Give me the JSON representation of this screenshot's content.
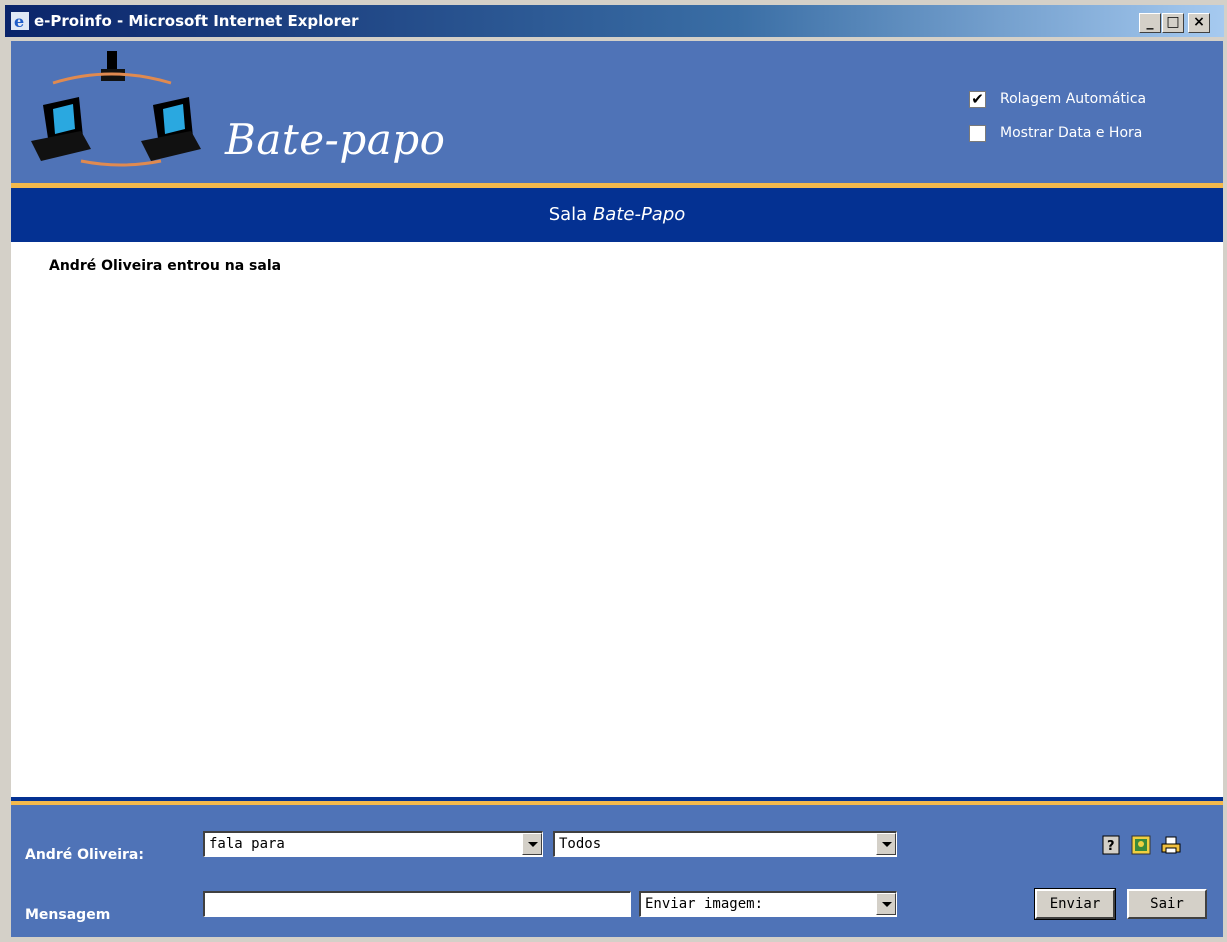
{
  "window": {
    "title": "e-Proinfo - Microsoft Internet Explorer",
    "minimize": "_",
    "maximize": "□",
    "close": "×"
  },
  "header": {
    "brand": "Bate-papo",
    "options": [
      {
        "label": "Rolagem Automática",
        "checked": true
      },
      {
        "label": "Mostrar Data e Hora",
        "checked": false
      }
    ]
  },
  "room": {
    "prefix": "Sala",
    "name": "Bate-Papo"
  },
  "chat": {
    "messages": [
      "André Oliveira entrou na sala"
    ]
  },
  "footer": {
    "user_label": "André Oliveira:",
    "message_label": "Mensagem",
    "speech_select": "fala para",
    "recipient_select": "Todos",
    "message_value": "",
    "image_select": "Enviar imagem:",
    "send_button": "Enviar",
    "exit_button": "Sair",
    "icons": [
      "help-icon",
      "image-icon",
      "print-icon"
    ]
  },
  "colors": {
    "header_blue": "#4f73b7",
    "dark_blue": "#043192",
    "gold": "#f3b94c"
  }
}
